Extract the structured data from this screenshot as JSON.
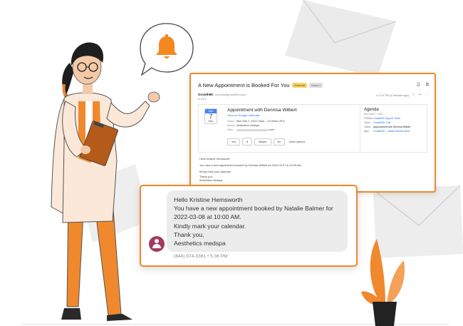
{
  "email": {
    "subject": "A New Appointment is Booked For You",
    "badge_external": "External",
    "badge_inbox": "Inbox ×",
    "print_icon": "print-icon",
    "open_icon": "open-new-window-icon",
    "sender_name": "Growth99",
    "sender_email": "<events@growth99.plus>",
    "to_line": "to me ▾",
    "time": "3:37 PM (2 minutes ago)",
    "invite": {
      "month": "Mar",
      "day": "7",
      "dow": "Mon",
      "title": "Appointment with Dennisa Wilbert",
      "link": "View on Google Calendar",
      "when_label": "When",
      "when_value": "Mon Mar 7, 2022 10am – 10:30am (IST)",
      "where_label": "Where",
      "where_value": "Aesthetics medspa",
      "who_label": "Who",
      "who_suffix": ".com*",
      "rsvp_yes": "Yes",
      "rsvp_caret": "▾",
      "rsvp_maybe": "Maybe",
      "rsvp_no": "No",
      "more_options": "More options"
    },
    "agenda": {
      "title": "Agenda",
      "date": "Mon Mar 7, 2022",
      "rows": [
        {
          "time": "9:30am",
          "text": "Growth99 Support Team"
        },
        {
          "time": "10am",
          "text": "Growth99+ Call"
        },
        {
          "time": "10am",
          "text": "Appointment with Dennisa Wilbert"
        },
        {
          "time": "6pm",
          "text": "Growth99+ – Weak Review Meet"
        }
      ]
    },
    "body": {
      "greeting": "Hello Kristine Hemsworth",
      "line1": "You have a new appointment booked by Dennisa Wilbert for 2022-03-07 at 10:00 AM.",
      "line2": "Kindly mark your calendar.",
      "line3": "Thank you,",
      "line4": "Aesthetics medspa"
    }
  },
  "sms": {
    "lines": [
      "Hello Kristine Hemsworth",
      "You have a new appointment booked by Natalie Balmer for",
      "2022-03-08 at 10:00 AM.",
      "Kindly mark your calendar.",
      "Thank you,",
      "Aesthetics medspa"
    ],
    "meta": "(844) 974-3361 • 5:36 PM"
  },
  "colors": {
    "accent": "#f0882d",
    "avatar": "#a33a5f",
    "bell": "#f4881e"
  }
}
